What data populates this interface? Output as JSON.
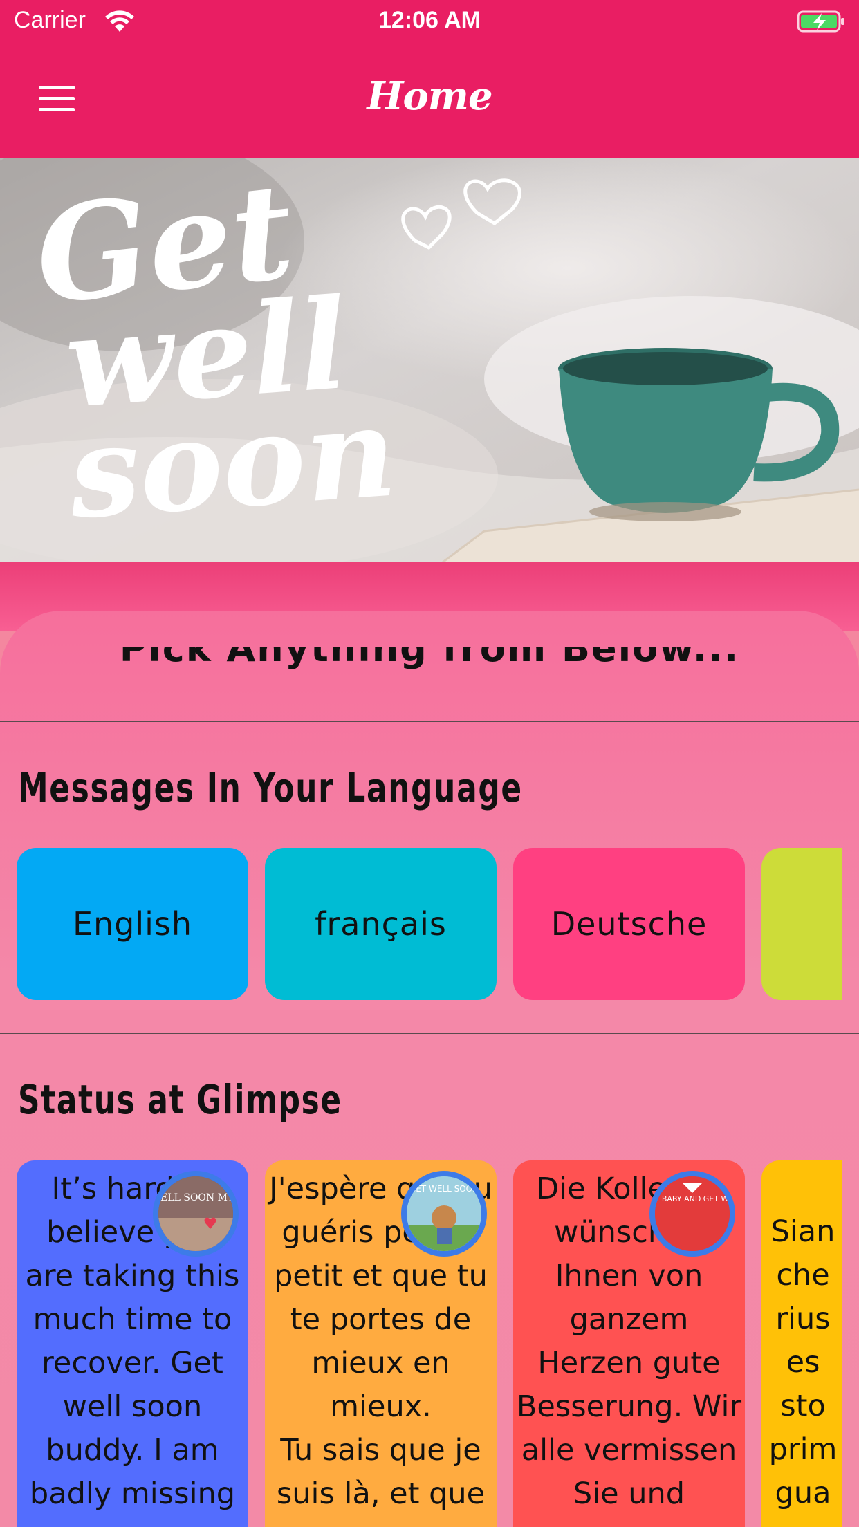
{
  "status_bar": {
    "carrier": "Carrier",
    "time": "12:06 AM"
  },
  "app_bar": {
    "title": "Home",
    "menu_icon": "hamburger-menu-icon"
  },
  "hero": {
    "text_line1": "Get",
    "text_line2": "well",
    "text_line3": "soon"
  },
  "pick_section": {
    "heading": "Pick Anything from Below..."
  },
  "languages": {
    "title": "Messages In Your Language",
    "items": [
      {
        "label": "English",
        "color": "#03a9f4"
      },
      {
        "label": "français",
        "color": "#00bcd4"
      },
      {
        "label": "Deutsche",
        "color": "#ff4081"
      },
      {
        "label": "",
        "color": "#cddc39"
      }
    ]
  },
  "status": {
    "title": "Status at Glimpse",
    "cards": [
      {
        "text": "It’s hard to\nbelieve you\nare taking this\nmuch time to\nrecover. Get\nwell soon\nbuddy. I am\nbadly missing",
        "color": "#536dfe",
        "avatar_text": "GET WELL SOON MY LOVE"
      },
      {
        "text": "J'espère que tu\nguéris petit à\npetit et que tu\nte portes de\nmieux en\nmieux.\nTu sais que je\nsuis là, et que",
        "color": "#ffab40",
        "avatar_text": "GET WELL SOON"
      },
      {
        "text": "Die Kollegen\nwünschen\nIhnen von\nganzem\nHerzen gute\nBesserung. Wir\nalle vermissen\nSie und",
        "color": "#ff5252",
        "avatar_text": "LOVE U MY BABY AND GET WELL SOON"
      },
      {
        "text": "Sian\nche\nrius\nes\nsto\nprim\ngua",
        "color": "#ffc107",
        "avatar_text": ""
      }
    ]
  }
}
